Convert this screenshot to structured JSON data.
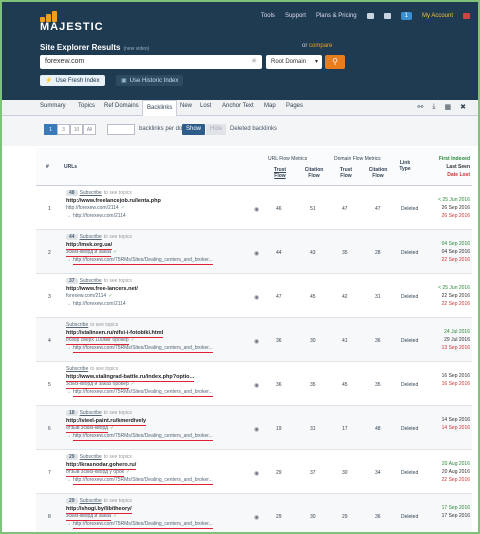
{
  "header": {
    "logo_text": "MAJESTIC",
    "nav": [
      "Tools",
      "Support",
      "Plans & Pricing"
    ],
    "badge": "1",
    "my_account": "My Account",
    "title": "Site Explorer Results",
    "title_note": "(new video)",
    "or_text": "or",
    "compare_link": "compare",
    "search_value": "forexew.com",
    "scope_select": "Root Domain",
    "fresh_index": "Use Fresh Index",
    "historic_index": "Use Historic Index"
  },
  "tabs": [
    "Summary",
    "Topics",
    "Ref Domains",
    "Backlinks",
    "New",
    "Lost",
    "Anchor Text",
    "Map",
    "Pages"
  ],
  "controls": {
    "pages": [
      "1",
      "3",
      "10",
      "All"
    ],
    "per_domain_label": "backlinks per domain",
    "show": "Show",
    "hide": "Hide",
    "deleted_label": "Deleted backlinks"
  },
  "table": {
    "headers": {
      "num": "#",
      "urls": "URLs",
      "url_flow": "URL Flow Metrics",
      "domain_flow": "Domain Flow Metrics",
      "trust_flow": "Trust Flow",
      "citation_flow": "Citation Flow",
      "link_type": "Link Type",
      "first_indexed": "First Indexed",
      "last_seen": "Last Seen",
      "date_lost": "Date Lost"
    },
    "rows": [
      {
        "num": "1",
        "refs": "48",
        "sub": "Subscribe",
        "sub_note": "to see topics",
        "source": "http://www.freelancejob.ru/lenta.php",
        "source_sub": "http://forexew.com/2114",
        "target": "http://forexew.com/2114",
        "tf": "46",
        "cf": "51",
        "dtf": "47",
        "dcf": "47",
        "type": "Deleted",
        "first": "< 25 Jun 2016",
        "last": "26 Sep 2016",
        "lost": "26 Sep 2016"
      },
      {
        "num": "2",
        "refs": "44",
        "sub": "Subscribe",
        "sub_note": "to see topics",
        "source": "http://msk.org.ua/",
        "source_sub": "эскиз-кворд и заказ",
        "target": "http://forexew.com/75RMs/Sites/Dealing_centers_and_broker...",
        "tf": "44",
        "cf": "43",
        "dtf": "35",
        "dcf": "28",
        "type": "Deleted",
        "first": "04 Sep 2016",
        "last": "04 Sep 2016",
        "lost": "22 Sep 2016"
      },
      {
        "num": "3",
        "refs": "37",
        "sub": "Subscribe",
        "sub_note": "to see topics",
        "source": "http://www.free-lancers.net/",
        "source_sub": "forexew.com/2114",
        "target": "http://forexew.com/2114",
        "tf": "47",
        "cf": "45",
        "dtf": "42",
        "dcf": "31",
        "type": "Deleted",
        "first": "< 25 Jun 2016",
        "last": "22 Sep 2016",
        "lost": "22 Sep 2016"
      },
      {
        "num": "4",
        "refs": "",
        "sub": "Subscribe",
        "sub_note": "to see topics",
        "source": "http://stalinsen.ru/nifsi-i-fotobiki.html",
        "source_sub": "обзор сверх 100мкг брокер",
        "target": "http://forexew.com/75RMs/Sites/Dealing_centers_and_broker...",
        "tf": "36",
        "cf": "30",
        "dtf": "41",
        "dcf": "36",
        "type": "Deleted",
        "first": "24 Jul 2016",
        "last": "29 Jul 2016",
        "lost": "13 Sep 2016"
      },
      {
        "num": "5",
        "refs": "",
        "sub": "Subscribe",
        "sub_note": "to see topics",
        "source": "http://www.stalingrad-battle.ru/index.php?optio...",
        "source_sub": "эскиз-кворд и заказ брокер",
        "target": "http://forexew.com/75RMs/Sites/Dealing_centers_and_broker...",
        "tf": "36",
        "cf": "35",
        "dtf": "45",
        "dcf": "35",
        "type": "Deleted",
        "first": "",
        "last": "16 Sep 2016",
        "lost": "16 Sep 2016"
      },
      {
        "num": "6",
        "refs": "18",
        "sub": "Subscribe",
        "sub_note": "to see topics",
        "source": "http://steel-paint.ru/kmerdively",
        "source_sub": "отзыв эскиз-кворд",
        "target": "http://forexew.com/75RMs/Sites/Dealing_centers_and_broker...",
        "tf": "19",
        "cf": "31",
        "dtf": "17",
        "dcf": "48",
        "type": "Deleted",
        "first": "",
        "last": "14 Sep 2016",
        "lost": "14 Sep 2016"
      },
      {
        "num": "7",
        "refs": "29",
        "sub": "Subscribe",
        "sub_note": "to see topics",
        "source": "http://krasnodar.gohero.ru/",
        "source_sub": "отзыв эскиз-кворд у брок",
        "target": "http://forexew.com/75RMs/Sites/Dealing_centers_and_broker...",
        "tf": "29",
        "cf": "37",
        "dtf": "30",
        "dcf": "34",
        "type": "Deleted",
        "first": "20 Aug 2016",
        "last": "20 Aug 2016",
        "lost": "22 Sep 2016"
      },
      {
        "num": "8",
        "refs": "29",
        "sub": "Subscribe",
        "sub_note": "to see topics",
        "source": "http://shogi.by/lib/theory/",
        "source_sub": "эскиз-кворд и заказ",
        "target": "http://forexew.com/75RMs/Sites/Dealing_centers_and_broker...",
        "tf": "29",
        "cf": "30",
        "dtf": "29",
        "dcf": "36",
        "type": "Deleted",
        "first": "17 Sep 2016",
        "last": "17 Sep 2016",
        "lost": ""
      }
    ]
  }
}
